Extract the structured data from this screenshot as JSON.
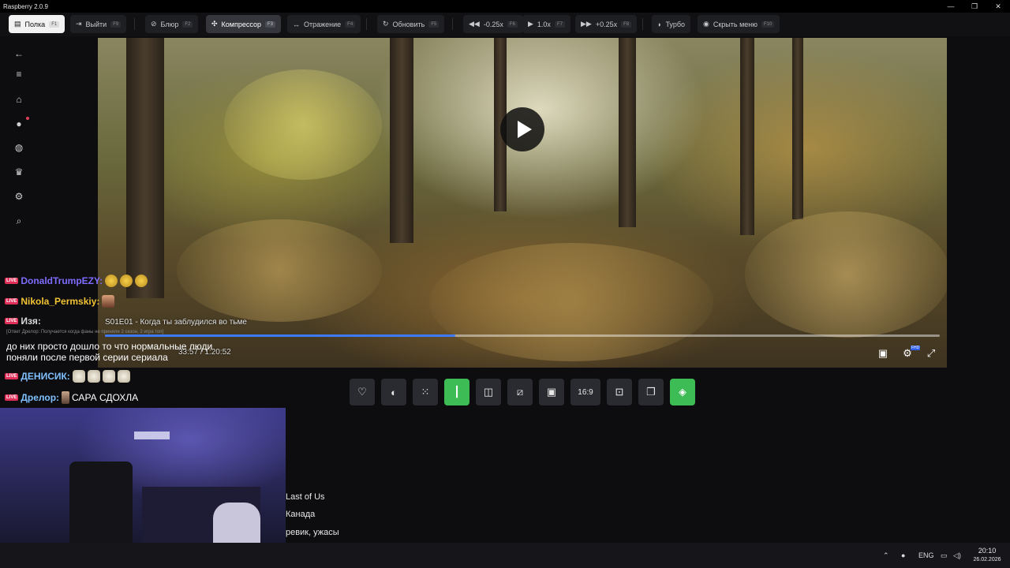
{
  "app": {
    "title": "Raspberry 2.0.9"
  },
  "window_controls": {
    "minimize": "—",
    "maximize": "❐",
    "close": "✕"
  },
  "toolbar": {
    "buttons": [
      {
        "label": "Полка",
        "key": "F1",
        "icon": "bookshelf-icon"
      },
      {
        "label": "Выйти",
        "key": "F9",
        "icon": "exit-icon"
      },
      {
        "label": "Блюр",
        "key": "F2",
        "icon": "blur-icon"
      },
      {
        "label": "Компрессор",
        "key": "F3",
        "icon": "compressor-icon"
      },
      {
        "label": "Отражение",
        "key": "F4",
        "icon": "mirror-icon"
      },
      {
        "label": "Обновить",
        "key": "F5",
        "icon": "refresh-icon"
      },
      {
        "label": "-0.25x",
        "key": "F6",
        "icon": "rewind-icon"
      },
      {
        "label": "1.0x",
        "key": "F7",
        "icon": "play-speed-icon"
      },
      {
        "label": "+0.25x",
        "key": "F8",
        "icon": "fast-forward-icon"
      },
      {
        "label": "Турбо",
        "key": "",
        "icon": "turbo-icon"
      },
      {
        "label": "Скрыть меню",
        "key": "F10",
        "icon": "eye-icon"
      }
    ]
  },
  "sidebar": {
    "icons": [
      "back-arrow-icon",
      "menu-icon",
      "home-icon",
      "fire-icon",
      "compass-icon",
      "trophy-icon",
      "gear-icon",
      "search-icon"
    ]
  },
  "player": {
    "episode_title": "S01E01 - Когда ты заблудился во тьме",
    "current_time": "33:57",
    "total_time": "1:20:52",
    "time_separator": "/",
    "progress": 0.42,
    "quality_badge": "FHD"
  },
  "chat": {
    "badge_text": "LIVE",
    "messages": [
      {
        "user": "DonaldTrumpEZY:",
        "color": "#7e6cff",
        "text": ""
      },
      {
        "user": "Nikola_Permskiy:",
        "color": "#f1c232",
        "text": ""
      },
      {
        "user": "Изя:",
        "color": "#d9d9d9",
        "text": ""
      },
      {
        "user": "ДЕНИСИК:",
        "color": "#7fc1ff",
        "text": ""
      },
      {
        "user": "Дрелор:",
        "color": "#7fc1ff",
        "text": "САРА СДОХЛА"
      }
    ],
    "reply_context": "[Ответ Дрелор: Получается когда фаны не приняли 2 сезон, 2 игра топ]",
    "multiline_message": "до них просто дошло то что нормальные люди поняли после первой серии сериала"
  },
  "action_bar": {
    "buttons": [
      {
        "name": "favorite-button",
        "icon": "heart-icon",
        "label": "",
        "green": false
      },
      {
        "name": "night-mode-button",
        "icon": "moon-icon",
        "label": "",
        "green": false
      },
      {
        "name": "grain-button",
        "icon": "grain-icon",
        "label": "",
        "green": false
      },
      {
        "name": "audio-button",
        "icon": "audio-wave-icon",
        "label": "",
        "green": true
      },
      {
        "name": "split-button",
        "icon": "split-icon",
        "label": "",
        "green": false
      },
      {
        "name": "picture-button",
        "icon": "picture-icon",
        "label": "",
        "green": false
      },
      {
        "name": "pip-button",
        "icon": "pip-icon",
        "label": "",
        "green": false
      },
      {
        "name": "aspect-ratio-button",
        "icon": "aspect-icon",
        "label": "16:9",
        "green": false
      },
      {
        "name": "screenshot-button",
        "icon": "screenshot-icon",
        "label": "",
        "green": false
      },
      {
        "name": "copy-button",
        "icon": "copy-icon",
        "label": "",
        "green": false
      },
      {
        "name": "layers-button",
        "icon": "layers-icon",
        "label": "",
        "green": true
      }
    ]
  },
  "description_lines": [
    "Last of Us",
    "Канада",
    "ревик, ужасы"
  ],
  "taskbar": {
    "language": "ENG",
    "time": "20:10",
    "date": "26.02.2026"
  },
  "colors": {
    "accent_green": "#3dbb54",
    "progress_blue": "#3c7bff",
    "live_badge": "#e0305a"
  }
}
